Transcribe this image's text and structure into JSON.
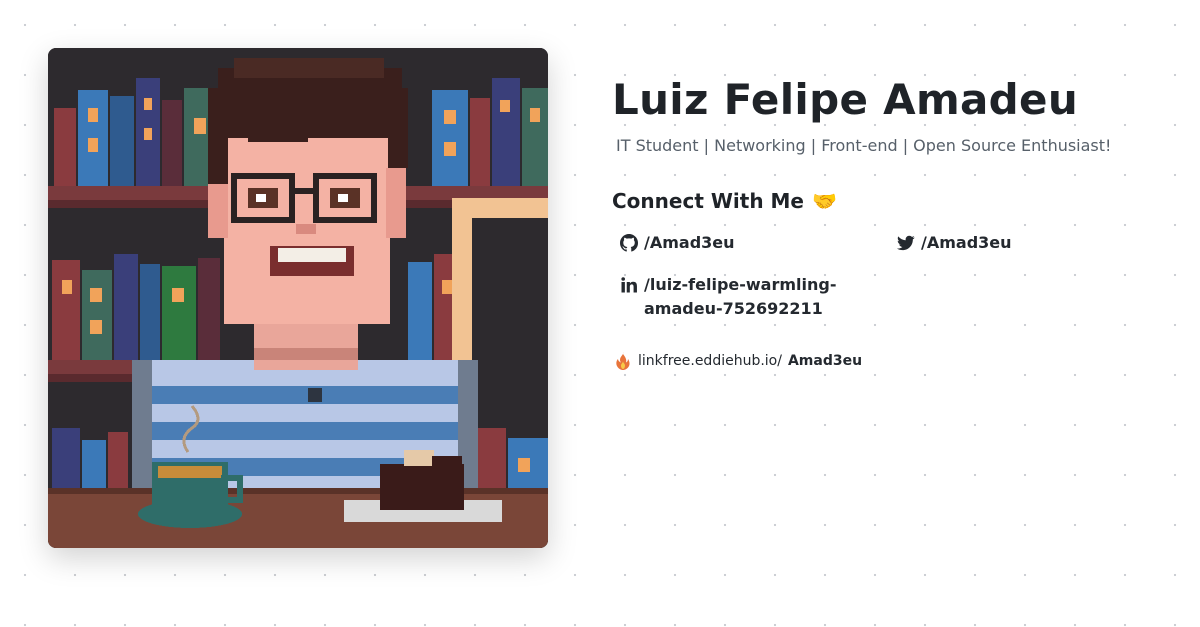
{
  "profile": {
    "name": "Luiz Felipe Amadeu",
    "tagline": "IT Student | Networking | Front-end | Open Source Enthusiast!"
  },
  "connect": {
    "heading": "Connect With Me",
    "emoji": "🤝"
  },
  "links": [
    {
      "icon": "github-icon",
      "label": "/Amad3eu"
    },
    {
      "icon": "twitter-icon",
      "label": "/Amad3eu"
    },
    {
      "icon": "linkedin-icon",
      "label": "/luiz-felipe-warmling-amadeu-752692211"
    }
  ],
  "linkfree": {
    "icon": "linkfree-flame-icon",
    "domain": "linkfree.eddiehub.io/",
    "user": "Amad3eu"
  },
  "colors": {
    "background": "#ffffff",
    "text": "#1f2328",
    "muted": "#57606a",
    "dot": "#c9ccd1"
  }
}
